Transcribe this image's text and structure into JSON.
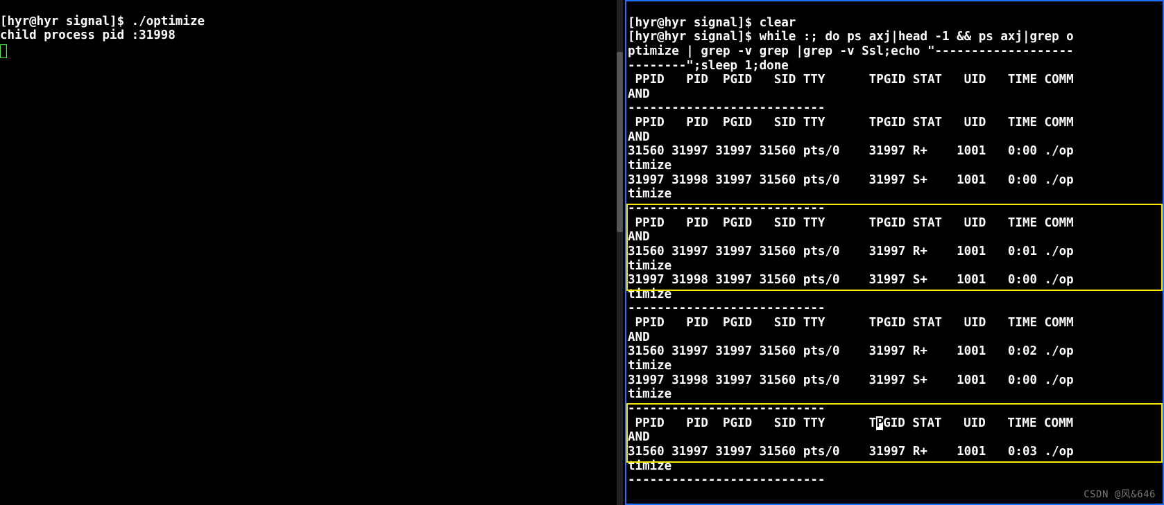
{
  "left_pane": {
    "prompt1": "[hyr@hyr signal]$ ",
    "cmd1": "./optimize",
    "line2": "child process pid :31998"
  },
  "right_pane": {
    "prompt1": "[hyr@hyr signal]$ ",
    "cmd1": "clear",
    "prompt2": "[hyr@hyr signal]$ ",
    "cmd2_l1": "while :; do ps axj|head -1 && ps axj|grep o",
    "cmd2_l2": "ptimize | grep -v grep |grep -v Ssl;echo \"-------------------",
    "cmd2_l3": "--------\";sleep 1;done",
    "header": " PPID   PID  PGID   SID TTY      TPGID STAT   UID   TIME COMM",
    "header_wrap": "AND",
    "sep": "---------------------------",
    "r1a": "31560 31997 31997 31560 pts/0    31997 R+    1001   0:00 ./op",
    "r1a_w": "timize",
    "r1b": "31997 31998 31997 31560 pts/0    31997 S+    1001   0:00 ./op",
    "r1b_w": "timize",
    "r2a": "31560 31997 31997 31560 pts/0    31997 R+    1001   0:01 ./op",
    "r2a_w": "timize",
    "r2b": "31997 31998 31997 31560 pts/0    31997 S+    1001   0:00 ./op",
    "r2b_w": "timize",
    "r3a": "31560 31997 31997 31560 pts/0    31997 R+    1001   0:02 ./op",
    "r3a_w": "timize",
    "r3b": "31997 31998 31997 31560 pts/0    31997 S+    1001   0:00 ./op",
    "r3b_w": "timize",
    "r4_header_pre": " PPID   PID  PGID   SID TTY      T",
    "r4_header_cur": "P",
    "r4_header_post": "GID STAT   UID   TIME COMM",
    "r4a": "31560 31997 31997 31560 pts/0    31997 R+    1001   0:03 ./op",
    "r4a_w": "timize"
  },
  "watermark": "CSDN @风&646"
}
